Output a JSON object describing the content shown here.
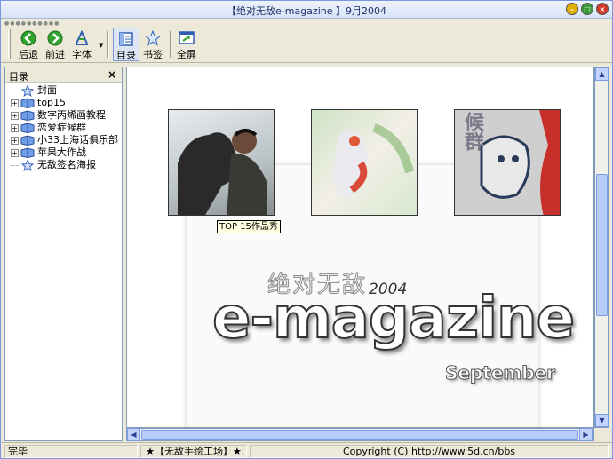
{
  "window": {
    "title": "【绝对无敌e-magazine 】9月2004",
    "min_label": "–",
    "max_label": "□",
    "close_label": "×"
  },
  "toolbar": {
    "back": "后退",
    "forward": "前进",
    "font": "字体",
    "toc": "目录",
    "bookmark": "书签",
    "fullscreen": "全屏"
  },
  "sidebar": {
    "title": "目录",
    "close": "×",
    "items": [
      {
        "label": "封面",
        "expandable": false
      },
      {
        "label": "top15",
        "expandable": true
      },
      {
        "label": "数字丙烯画教程",
        "expandable": true
      },
      {
        "label": "恋爱症候群",
        "expandable": true
      },
      {
        "label": "小33上海话俱乐部",
        "expandable": true
      },
      {
        "label": "苹果大作战",
        "expandable": true
      },
      {
        "label": "无敌签名海报",
        "expandable": false
      }
    ]
  },
  "content": {
    "tooltip": "TOP 15作品秀",
    "mag_cn": "绝对无敌",
    "mag_year": "2004",
    "mag_title": "e-magazine",
    "mag_month": "September",
    "thumb3_text": "候群"
  },
  "status": {
    "left": "完毕",
    "center": "★【无敌手绘工场】★",
    "right": "Copyright (C) http://www.5d.cn/bbs"
  },
  "colors": {
    "accent": "#7a96df",
    "scroll": "#b9cdfb"
  }
}
